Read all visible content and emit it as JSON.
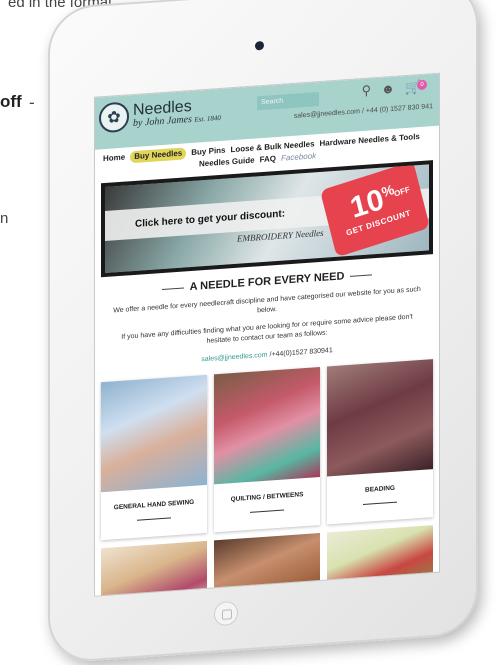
{
  "background_page": {
    "top_text": "ed in the format",
    "off_text": "off",
    "dash_text": "-",
    "line_text": "n"
  },
  "header": {
    "logo_name": "Needles",
    "logo_sub": "by John James",
    "logo_est": "Est. 1840",
    "search_placeholder": "Search",
    "contact_email": "sales@jjneedles.com",
    "contact_phone": " / +44 (0) 1527 830 941",
    "cart_count": "0",
    "icons": [
      "search-icon",
      "user-icon",
      "cart-icon"
    ]
  },
  "nav": {
    "row1": [
      "Home",
      "Buy Needles",
      "Buy Pins",
      "Loose & Bulk Needles",
      "Hardware Needles & Tools"
    ],
    "row2": [
      "Needles Guide",
      "FAQ",
      "Facebook"
    ],
    "active": "Buy Needles"
  },
  "banner": {
    "cta": "Click here to get your discount:",
    "brand": "EMBROIDERY Needles",
    "percent": "10",
    "percent_sign": "%",
    "off": "OFF",
    "get_discount": "GET DISCOUNT"
  },
  "main": {
    "headline": "A NEEDLE FOR EVERY NEED",
    "intro1": "We offer a needle for every needlecraft discipline and have categorised our website for you as such below.",
    "intro2": "If you have any difficulties finding what you are looking for or require some advice please don't hesitate to contact our team as follows:",
    "contact_email": "sales@jjneedles.com",
    "contact_phone": " /+44(0)1527 830941"
  },
  "categories": [
    {
      "label": "GENERAL HAND SEWING"
    },
    {
      "label": "QUILTING / BETWEENS"
    },
    {
      "label": "BEADING"
    }
  ],
  "colors": {
    "header_bg": "#a8d2cc",
    "nav_active": "#e0d65a",
    "tag_red": "#e7434f",
    "link_teal": "#2f9a8f"
  }
}
